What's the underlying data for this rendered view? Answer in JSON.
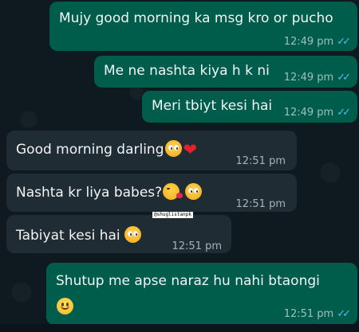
{
  "chat": {
    "messages": [
      {
        "direction": "outgoing",
        "text": "Mujy good morning ka msg kro or pucho",
        "time": "12:49 pm",
        "status": "read"
      },
      {
        "direction": "outgoing",
        "text": "Me ne nashta kiya h k ni",
        "time": "12:49 pm",
        "status": "read"
      },
      {
        "direction": "outgoing",
        "text": "Meri tbiyt kesi hai",
        "time": "12:49 pm",
        "status": "read"
      },
      {
        "direction": "incoming",
        "text": "Good morning darling",
        "emojis": [
          "pleading-face",
          "red-heart"
        ],
        "time": "12:51 pm"
      },
      {
        "direction": "incoming",
        "text": "Nashta kr liya babes?",
        "emojis": [
          "kissing-face",
          "pleading-face"
        ],
        "time": "12:51 pm"
      },
      {
        "direction": "incoming",
        "text": "Tabiyat kesi hai",
        "emojis": [
          "pleading-face"
        ],
        "time": "12:51 pm"
      },
      {
        "direction": "outgoing",
        "text": "Shutup me apse naraz hu nahi btaongi",
        "emojis": [
          "smiling-face"
        ],
        "time": "12:51 pm",
        "status": "read"
      }
    ]
  },
  "overlay": {
    "watermark": "@shuglistanpk"
  },
  "colors": {
    "outgoing_bubble": "#005c4b",
    "incoming_bubble": "#202c33",
    "background": "#0b141a",
    "read_ticks": "#53bdeb"
  }
}
